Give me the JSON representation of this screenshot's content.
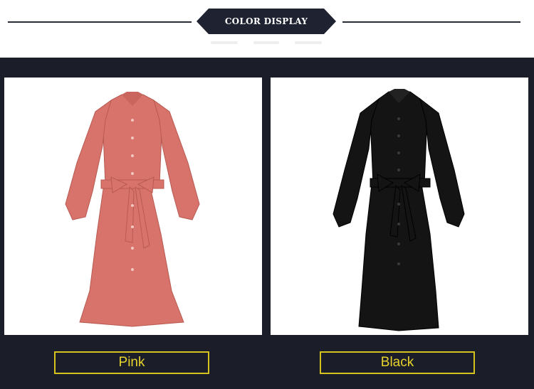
{
  "header": {
    "badge_text": "COLOR DISPLAY"
  },
  "colors": {
    "page_background": "#1b1e28",
    "badge_background": "#1f2230",
    "label_border": "#d6c21e",
    "label_text": "#e6d22c",
    "pink_dress": "#d7736a",
    "black_dress": "#141414"
  },
  "products": [
    {
      "label": "Pink",
      "image": "pink-shirt-dress-image"
    },
    {
      "label": "Black",
      "image": "black-shirt-dress-image"
    }
  ]
}
